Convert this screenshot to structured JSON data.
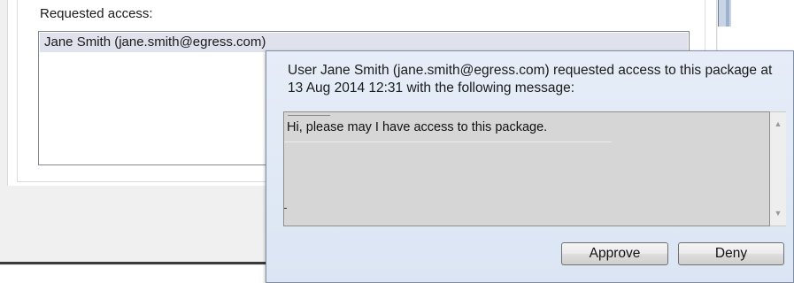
{
  "background_dialog": {
    "requested_label": "Requested access:",
    "requested_items": [
      {
        "text": "Jane Smith (jane.smith@egress.com)"
      }
    ]
  },
  "popup": {
    "message": "User Jane Smith (jane.smith@egress.com) requested access to this package at 13 Aug 2014 12:31 with the following message:",
    "request_message_text": "Hi, please may I have access to this package.",
    "buttons": {
      "approve_label": "Approve",
      "deny_label": "Deny"
    },
    "scrollbar": {
      "up_icon": "▲",
      "down_icon": "▼"
    }
  }
}
